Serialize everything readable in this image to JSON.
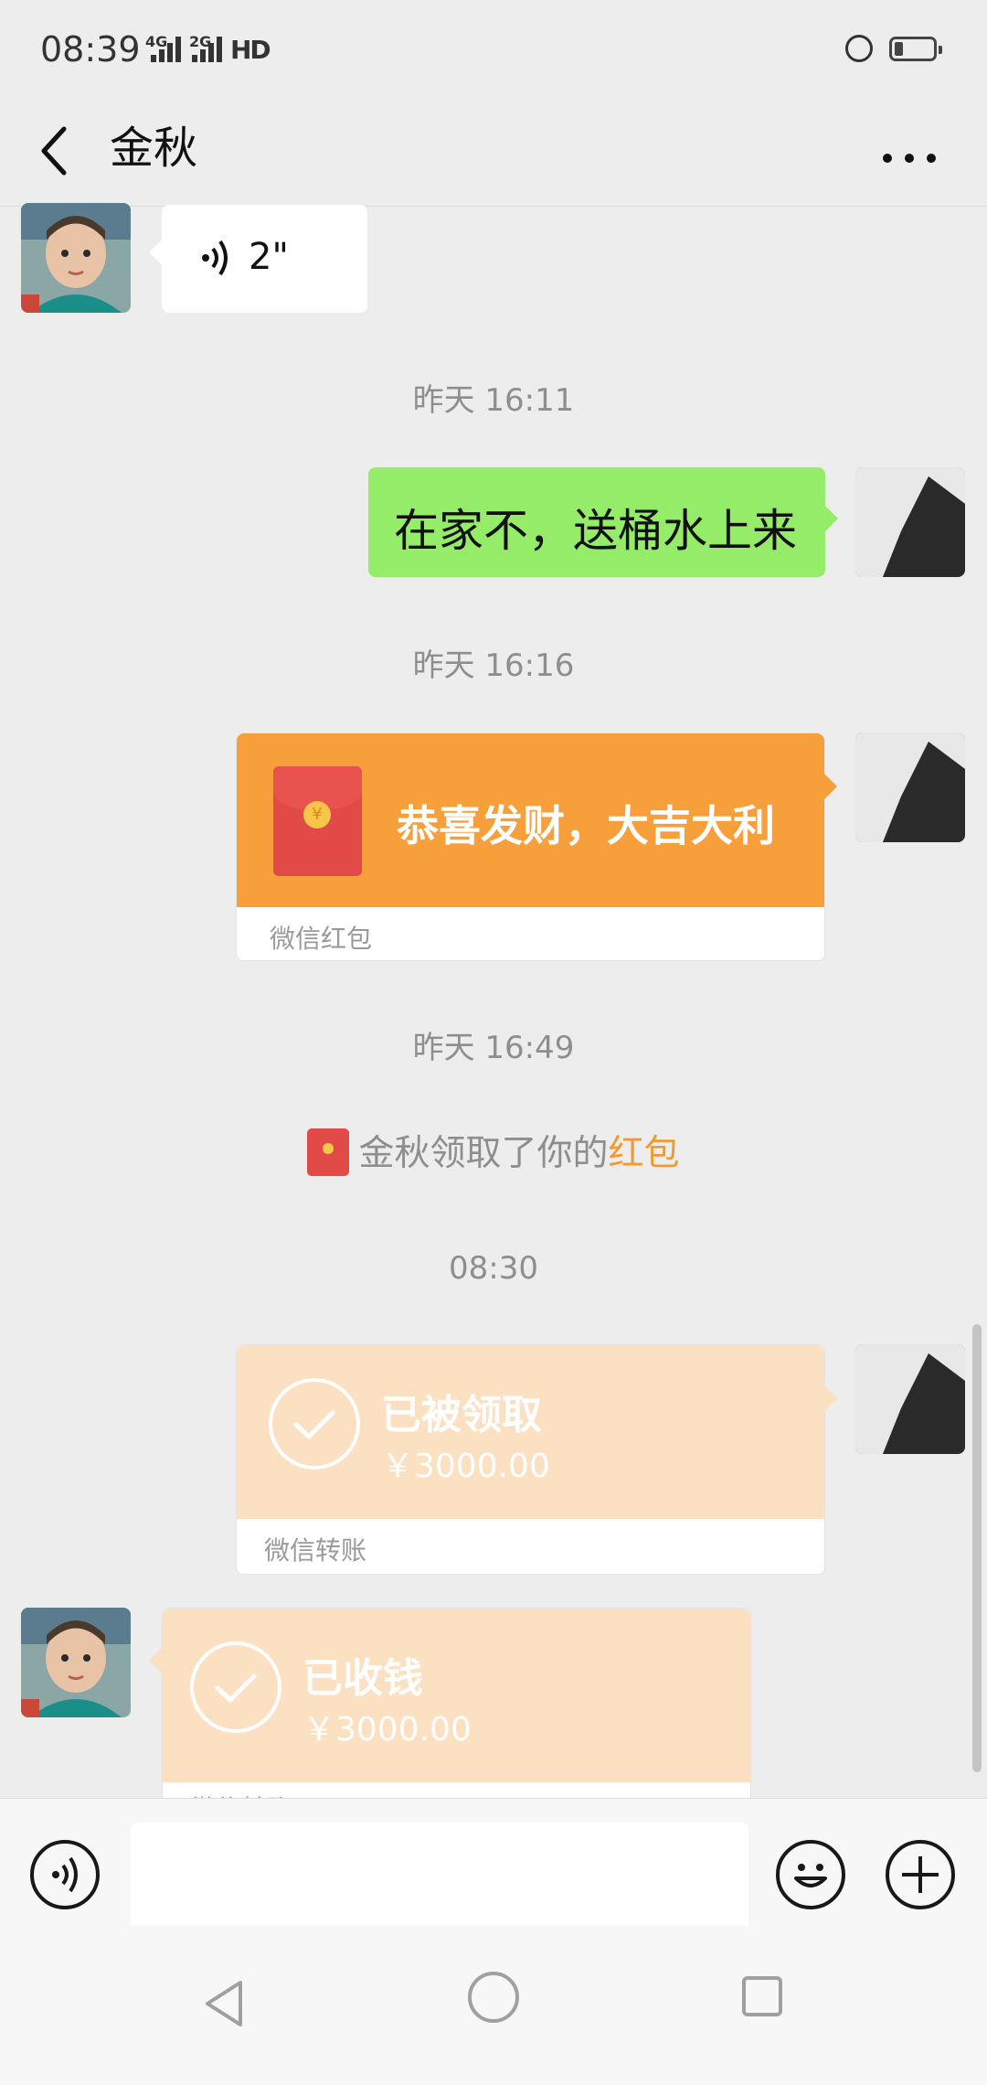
{
  "status_bar": {
    "time": "08:39",
    "signal1": "4G",
    "signal2": "2G",
    "hd": "HD"
  },
  "header": {
    "title": "金秋",
    "back_icon": "chevron-left-icon",
    "more_icon": "more-horizontal-icon"
  },
  "messages": {
    "voice": {
      "duration": "2\""
    },
    "ts1": "昨天 16:11",
    "text1": "在家不，送桶水上来",
    "ts2": "昨天 16:16",
    "red_packet": {
      "title": "恭喜发财，大吉大利",
      "label": "微信红包"
    },
    "ts3": "昨天 16:49",
    "notice": {
      "prefix": "金秋领取了你的",
      "highlight": "红包"
    },
    "ts4": "08:30",
    "transfer_sent": {
      "status": "已被领取",
      "amount": "￥3000.00",
      "label": "微信转账"
    },
    "transfer_received": {
      "status": "已收钱",
      "amount": "￥3000.00",
      "label": "微信转账"
    }
  },
  "input": {
    "placeholder": "",
    "voice_icon": "voice-mode-icon",
    "emoji_icon": "emoji-icon",
    "plus_icon": "plus-icon"
  },
  "nav": {
    "back": "nav-back-icon",
    "home": "nav-home-icon",
    "recent": "nav-recent-icon"
  },
  "colors": {
    "bubble_green": "#95EC69",
    "red_packet": "#F79F3A",
    "transfer_done": "#FCE0C2",
    "accent": "#F39A2F"
  }
}
